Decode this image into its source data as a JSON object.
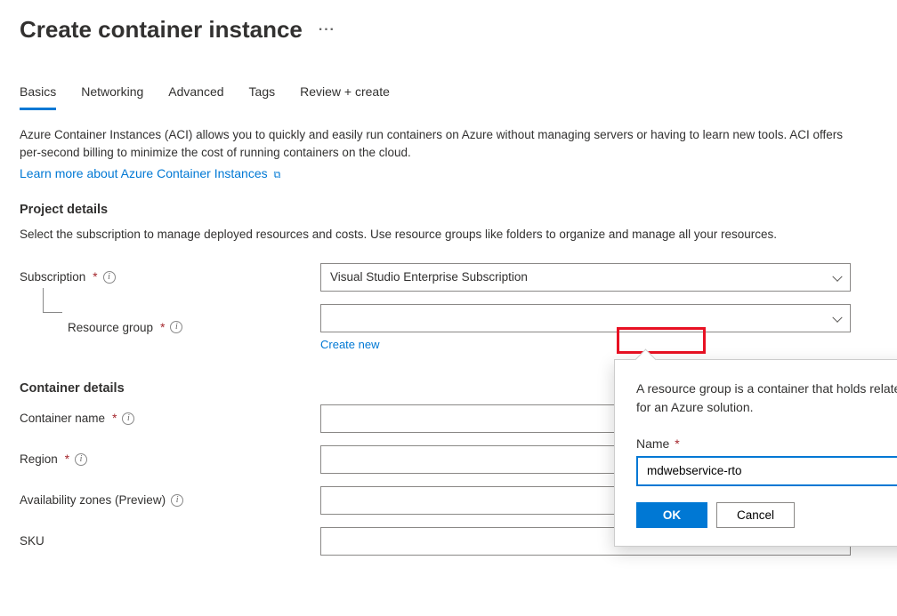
{
  "page": {
    "title": "Create container instance"
  },
  "tabs": {
    "basics": "Basics",
    "networking": "Networking",
    "advanced": "Advanced",
    "tags": "Tags",
    "review": "Review + create"
  },
  "intro": {
    "text": "Azure Container Instances (ACI) allows you to quickly and easily run containers on Azure without managing servers or having to learn new tools. ACI offers per-second billing to minimize the cost of running containers on the cloud.",
    "link": "Learn more about Azure Container Instances"
  },
  "project": {
    "heading": "Project details",
    "description": "Select the subscription to manage deployed resources and costs. Use resource groups like folders to organize and manage all your resources.",
    "subscription_label": "Subscription",
    "subscription_value": "Visual Studio Enterprise Subscription",
    "resource_group_label": "Resource group",
    "resource_group_value": "",
    "create_new": "Create new"
  },
  "container": {
    "heading": "Container details",
    "name_label": "Container name",
    "region_label": "Region",
    "zones_label": "Availability zones (Preview)",
    "sku_label": "SKU"
  },
  "popover": {
    "description": "A resource group is a container that holds related resources for an Azure solution.",
    "name_label": "Name",
    "name_value": "mdwebservice-rto",
    "ok": "OK",
    "cancel": "Cancel"
  }
}
